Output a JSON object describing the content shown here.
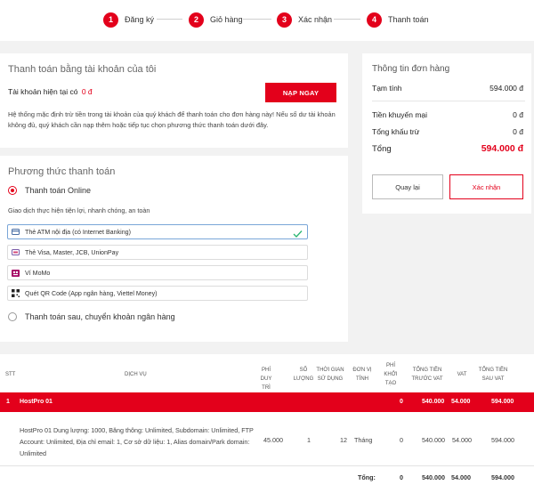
{
  "steps": [
    {
      "num": "1",
      "label": "Đăng ký"
    },
    {
      "num": "2",
      "label": "Giỏ hàng"
    },
    {
      "num": "3",
      "label": "Xác nhận"
    },
    {
      "num": "4",
      "label": "Thanh toán"
    }
  ],
  "account": {
    "title": "Thanh toán bằng tài khoản của tôi",
    "balance_label": "Tài khoản hiện tại có",
    "balance_value": "0 đ",
    "topup_label": "NẠP NGAY",
    "description": "Hệ thống mặc định trừ tiền trong tài khoản của quý khách để thanh toán cho đơn hàng này! Nếu số dư tài khoản không đủ, quý khách cần nạp thêm hoặc tiếp tục chọn phương thức thanh toán dưới đây."
  },
  "payment": {
    "title": "Phương thức thanh toán",
    "online_label": "Thanh toán Online",
    "online_desc": "Giao dịch thực hiện tiện lợi, nhanh chóng, an toàn",
    "options": [
      {
        "label": "Thẻ ATM nội địa (có Internet Banking)",
        "icon": "card-icon"
      },
      {
        "label": "Thẻ Visa, Master, JCB, UnionPay",
        "icon": "visa-card-icon"
      },
      {
        "label": "Ví MoMo",
        "icon": "momo-icon"
      },
      {
        "label": "Quét QR Code (App ngân hàng, Viettel Money)",
        "icon": "qr-code-icon"
      }
    ],
    "later_label": "Thanh toán sau, chuyển khoản ngân hàng"
  },
  "order": {
    "title": "Thông tin đơn hàng",
    "subtotal_label": "Tạm tính",
    "subtotal_value": "594.000 đ",
    "promo_label": "Tiền khuyến mại",
    "promo_value": "0 đ",
    "discount_label": "Tổng khấu trừ",
    "discount_value": "0 đ",
    "total_label": "Tổng",
    "total_value": "594.000 đ",
    "back_label": "Quay lại",
    "confirm_label": "Xác nhận"
  },
  "table": {
    "headers": {
      "stt": "STT",
      "service": "DỊCH VỤ",
      "fee": "PHÍ DUY TRÌ",
      "qty": "SỐ LƯỢNG",
      "duration": "THỜI GIAN SỬ DỤNG",
      "unit": "ĐƠN VỊ TÍNH",
      "init_fee": "PHÍ KHỞI TẠO",
      "pre_vat": "TỔNG TIỀN TRƯỚC VAT",
      "vat": "VAT",
      "post_vat": "TỔNG TIỀN SAU VAT"
    },
    "group": {
      "stt": "1",
      "name": "HostPro 01",
      "init_fee": "0",
      "pre_vat": "540.000",
      "vat": "54.000",
      "post_vat": "594.000"
    },
    "item": {
      "description": "HostPro 01 Dung lượng: 1000, Băng thông: Unlimited, Subdomain: Unlimited, FTP Account: Unlimited, Địa chỉ email: 1, Cơ sở dữ liệu: 1, Alias domain/Park domain: Unlimited",
      "fee": "45.000",
      "qty": "1",
      "duration": "12",
      "unit": "Tháng",
      "init_fee": "0",
      "pre_vat": "540.000",
      "vat": "54.000",
      "post_vat": "594.000"
    },
    "footer": {
      "label": "Tổng:",
      "init_fee": "0",
      "pre_vat": "540.000",
      "vat": "54.000",
      "post_vat": "594.000"
    }
  },
  "colors": {
    "accent": "#e3001b"
  }
}
